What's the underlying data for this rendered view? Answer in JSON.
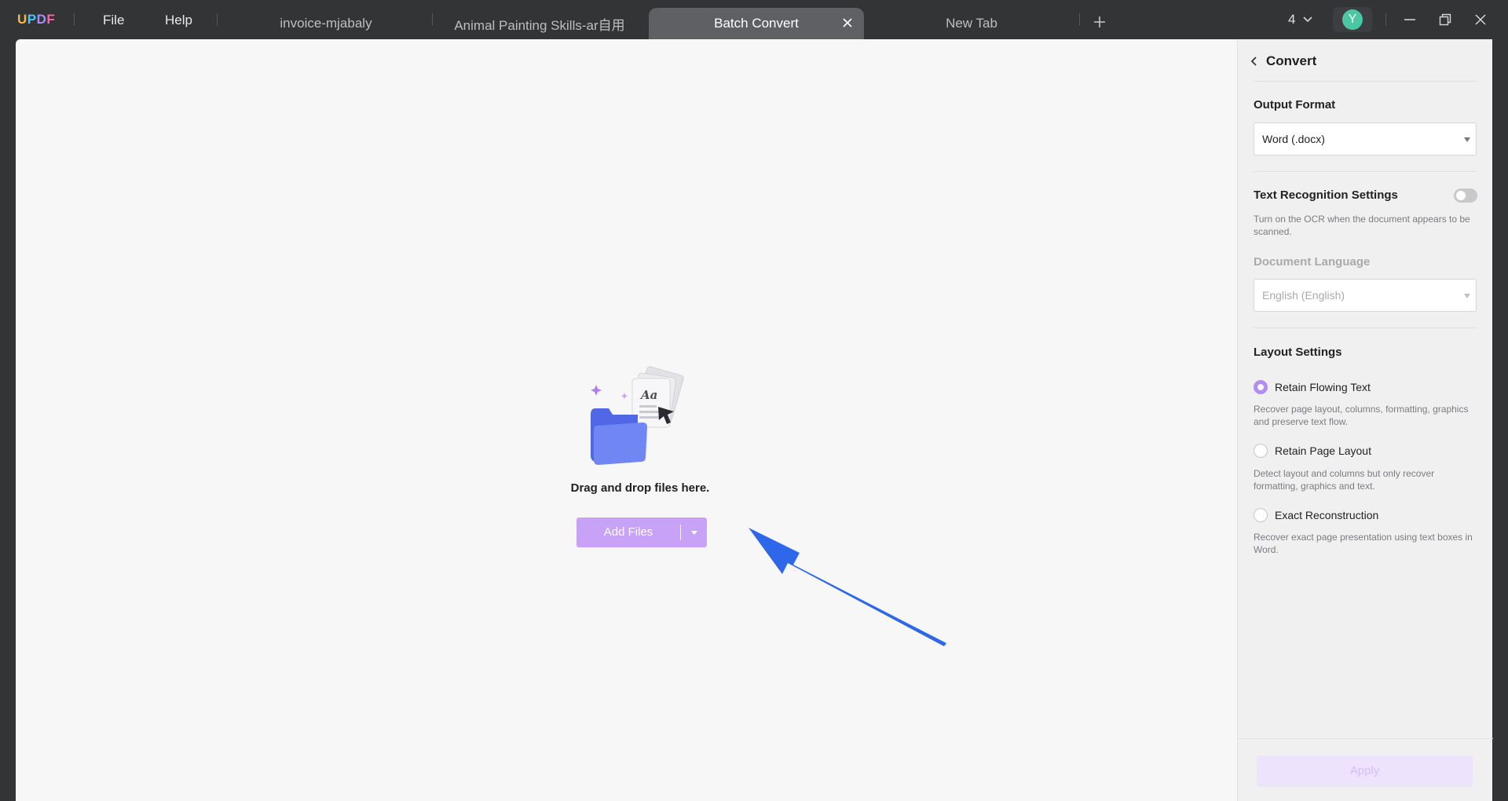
{
  "app": {
    "logo": {
      "u": "U",
      "p": "P",
      "d": "D",
      "f": "F"
    },
    "menu": {
      "file": "File",
      "help": "Help"
    },
    "tabs": [
      {
        "label": "invoice-mjabaly"
      },
      {
        "label": "Animal Painting Skills-ar自用"
      },
      {
        "label": "Batch Convert",
        "active": true
      },
      {
        "label": "New Tab"
      }
    ],
    "window_count": "4",
    "avatar_initial": "Y"
  },
  "main": {
    "drop_text": "Drag and drop files here.",
    "add_files_label": "Add Files",
    "illustration_text": "Aa"
  },
  "panel": {
    "title": "Convert",
    "output_format": {
      "heading": "Output Format",
      "value": "Word (.docx)"
    },
    "text_recognition": {
      "heading": "Text Recognition Settings",
      "enabled": false,
      "hint": "Turn on the OCR when the document appears to be scanned."
    },
    "document_language": {
      "heading": "Document Language",
      "value": "English (English)"
    },
    "layout": {
      "heading": "Layout Settings",
      "options": [
        {
          "label": "Retain Flowing Text",
          "selected": true,
          "hint": "Recover page layout, columns, formatting, graphics and preserve text flow."
        },
        {
          "label": "Retain Page Layout",
          "selected": false,
          "hint": "Detect layout and columns but only recover formatting, graphics and text."
        },
        {
          "label": "Exact Reconstruction",
          "selected": false,
          "hint": "Recover exact page presentation using text boxes in Word."
        }
      ]
    },
    "apply_label": "Apply"
  },
  "colors": {
    "accent": "#b48cf5",
    "add_button": "#c8a2f6",
    "annotation_arrow": "#2f67ea",
    "titlebar": "#333436"
  }
}
